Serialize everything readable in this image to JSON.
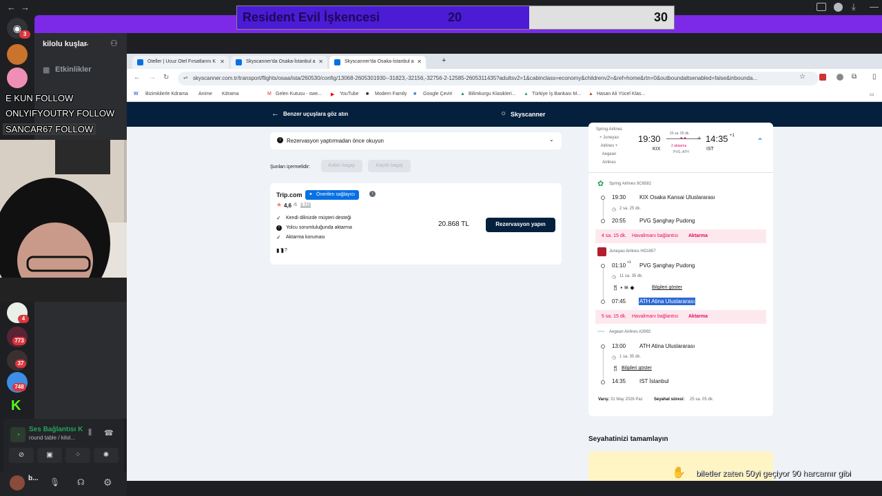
{
  "score": {
    "title": "Resident Evil İşkencesi",
    "left_value": "20",
    "right_value": "30"
  },
  "discord": {
    "server_badges": [
      "3",
      "4",
      "773",
      "37",
      "748"
    ],
    "guild_name": "kilolu kuşlar",
    "channel_events": "Etkinlikler",
    "follows": [
      "E  KUN  FOLLOW",
      "ONLYIFYOUTRY  FOLLOW",
      "SANCAR67  FOLLOW"
    ],
    "voice": {
      "title": "Ses Bağlantısı K",
      "subtitle": "round table / kilol..."
    },
    "user": {
      "name": "b..."
    }
  },
  "browser": {
    "tabs": [
      {
        "label": "Oteller | Ucuz Otel Fırsatlarını K"
      },
      {
        "label": "Skyscanner'da Osaka-İstanbul  a"
      },
      {
        "label": "Skyscanner'da Osaka-İstanbul  a"
      }
    ],
    "new_tab": "+",
    "url": "skyscanner.com.tr/transport/flights/osaa/ista/260530/config/13068-2605301930--31823,-32156,-32756-2-12585-2605311435?adultsv2=1&cabinclass=economy&childrenv2=&ref=home&rtn=0&outboundaltsenabled=false&inbounda...",
    "bookmarks": [
      "Bizimkilerle Kdrama",
      "Anime",
      "Kdrama",
      "Gelen Kutusu - swe...",
      "YouTube",
      "Modern Family",
      "Google Çeviri",
      "Bilimkurgu Klasikleri...",
      "Türkiye İş Bankası M...",
      "Hasan Ali Yücel Klas..."
    ]
  },
  "page": {
    "back_label": "Benzer uçuşlara göz atın",
    "brand": "Skyscanner",
    "read_before": "Rezervasyon yaptırmadan önce okuyun",
    "includes_label": "Şunları içermelidir:",
    "chip1": "Kabin bagajı",
    "chip2": "Kayıtlı bagaj",
    "provider": {
      "name": "Trip.com",
      "badge": "Önerilen sağlayıcı",
      "rating": "4,6",
      "rating_scale": "/5",
      "reviews": "3.723",
      "features": [
        "Kendi dilinizde müşteri desteği",
        "Yolcu sorumluluğunda aktarma",
        "Aktarma koruması"
      ],
      "bag_icons": "?  ?",
      "price": "20.868 TL",
      "cta": "Rezervasyon yapın"
    },
    "summary": {
      "airlines": [
        "Spring Airlines",
        "+ Juneyao",
        "Airlines +",
        "Aegean",
        "Airlines"
      ],
      "dep_time": "19:30",
      "dep_code": "KIX",
      "duration": "25 sa. 05 dk.",
      "stops": "2 aktarma",
      "stop_codes": "PVG, ATH",
      "arr_time": "14:35",
      "arr_day": "+1",
      "arr_code": "IST"
    },
    "legs": [
      {
        "airline": "Spring Airlines 9C6582",
        "dep_time": "19:30",
        "dep_airport": "KIX Osaka Kansai Uluslararası",
        "duration": "2 sa. 25 dk.",
        "arr_time": "20:55",
        "arr_airport": "PVG Şanghay Pudong"
      },
      {
        "airline": "Juneyao Airlines HO1657",
        "dep_time": "01:10",
        "dep_day": "+1",
        "dep_airport": "PVG Şanghay Pudong",
        "duration": "11 sa. 35 dk.",
        "info": "Bilgileri göster",
        "arr_time": "07:45",
        "arr_airport": "ATH Atina Uluslararası"
      },
      {
        "airline": "Aegean Airlines A3992",
        "dep_time": "13:00",
        "dep_airport": "ATH Atina Uluslararası",
        "duration": "1 sa. 35 dk.",
        "info": "Bilgileri göster",
        "arr_time": "14:35",
        "arr_airport": "IST İstanbul"
      }
    ],
    "layovers": [
      {
        "duration": "4 sa. 15 dk.",
        "text": "Havalimanı bağlantısı",
        "tag": "Aktarma"
      },
      {
        "duration": "5 sa. 15 dk.",
        "text": "Havalimanı bağlantısı",
        "tag": "Aktarma"
      }
    ],
    "arrival_label": "Varış:",
    "arrival_date": "31 May 2026 Paz",
    "trip_label": "Seyahat süresi:",
    "trip_duration": "25 sa. 05 dk.",
    "complete_title": "Seyahatinizi tamamlayın"
  },
  "chat_overlay": "biletler zaten 50yi geçiyor 90 harcamır gibi"
}
